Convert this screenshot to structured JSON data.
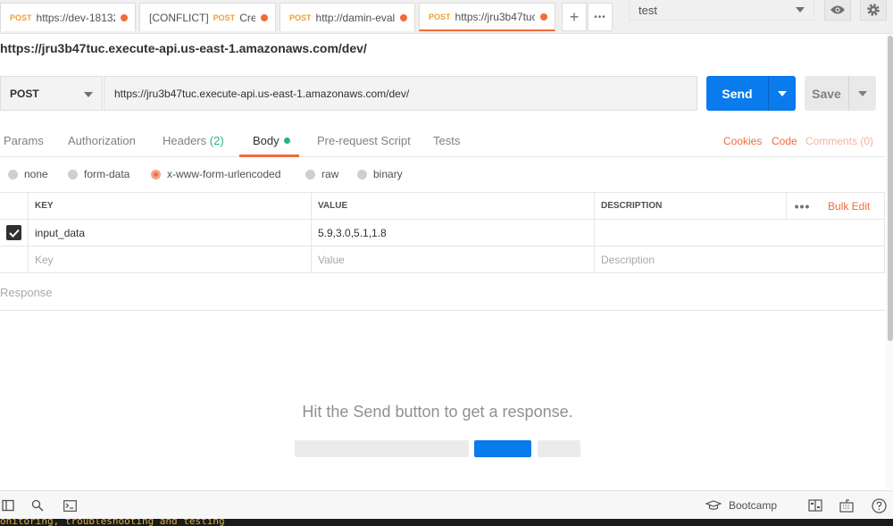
{
  "tabs": [
    {
      "method": "POST",
      "prefix": "",
      "title": "https://dev-18132!",
      "unsaved": true
    },
    {
      "method": "POST",
      "prefix": "[CONFLICT]",
      "title": "Create",
      "unsaved": true
    },
    {
      "method": "POST",
      "prefix": "",
      "title": "http://damin-eval-",
      "unsaved": true
    },
    {
      "method": "POST",
      "prefix": "",
      "title": "https://jru3b47tuc",
      "unsaved": true,
      "active": true
    }
  ],
  "tab_actions": {
    "new_tab": "+",
    "more": "•••"
  },
  "environment": {
    "selected": "test"
  },
  "request": {
    "title": "https://jru3b47tuc.execute-api.us-east-1.amazonaws.com/dev/",
    "method": "POST",
    "url": "https://jru3b47tuc.execute-api.us-east-1.amazonaws.com/dev/",
    "send_label": "Send",
    "save_label": "Save"
  },
  "request_tabs": [
    {
      "label": "Params"
    },
    {
      "label": "Authorization"
    },
    {
      "label": "Headers",
      "count": "(2)"
    },
    {
      "label": "Body",
      "active": true
    },
    {
      "label": "Pre-request Script"
    },
    {
      "label": "Tests"
    }
  ],
  "request_links": {
    "cookies": "Cookies",
    "code": "Code",
    "comments": "Comments (0)"
  },
  "body_types": [
    {
      "label": "none"
    },
    {
      "label": "form-data"
    },
    {
      "label": "x-www-form-urlencoded",
      "selected": true
    },
    {
      "label": "raw"
    },
    {
      "label": "binary"
    }
  ],
  "kv_table": {
    "headers": {
      "key": "KEY",
      "value": "VALUE",
      "description": "DESCRIPTION"
    },
    "bulk_edit": "Bulk Edit",
    "rows": [
      {
        "checked": true,
        "key": "input_data",
        "value": "5.9,3.0,5.1,1.8",
        "description": ""
      }
    ],
    "placeholders": {
      "key": "Key",
      "value": "Value",
      "description": "Description"
    }
  },
  "response": {
    "label": "Response",
    "empty_message": "Hit the Send button to get a response."
  },
  "statusbar": {
    "bootcamp": "Bootcamp"
  },
  "console_text": "onitoring, troubleshooting and testing",
  "colors": {
    "accent": "#f26b3a",
    "primary": "#097bed",
    "success": "#26b47f"
  }
}
